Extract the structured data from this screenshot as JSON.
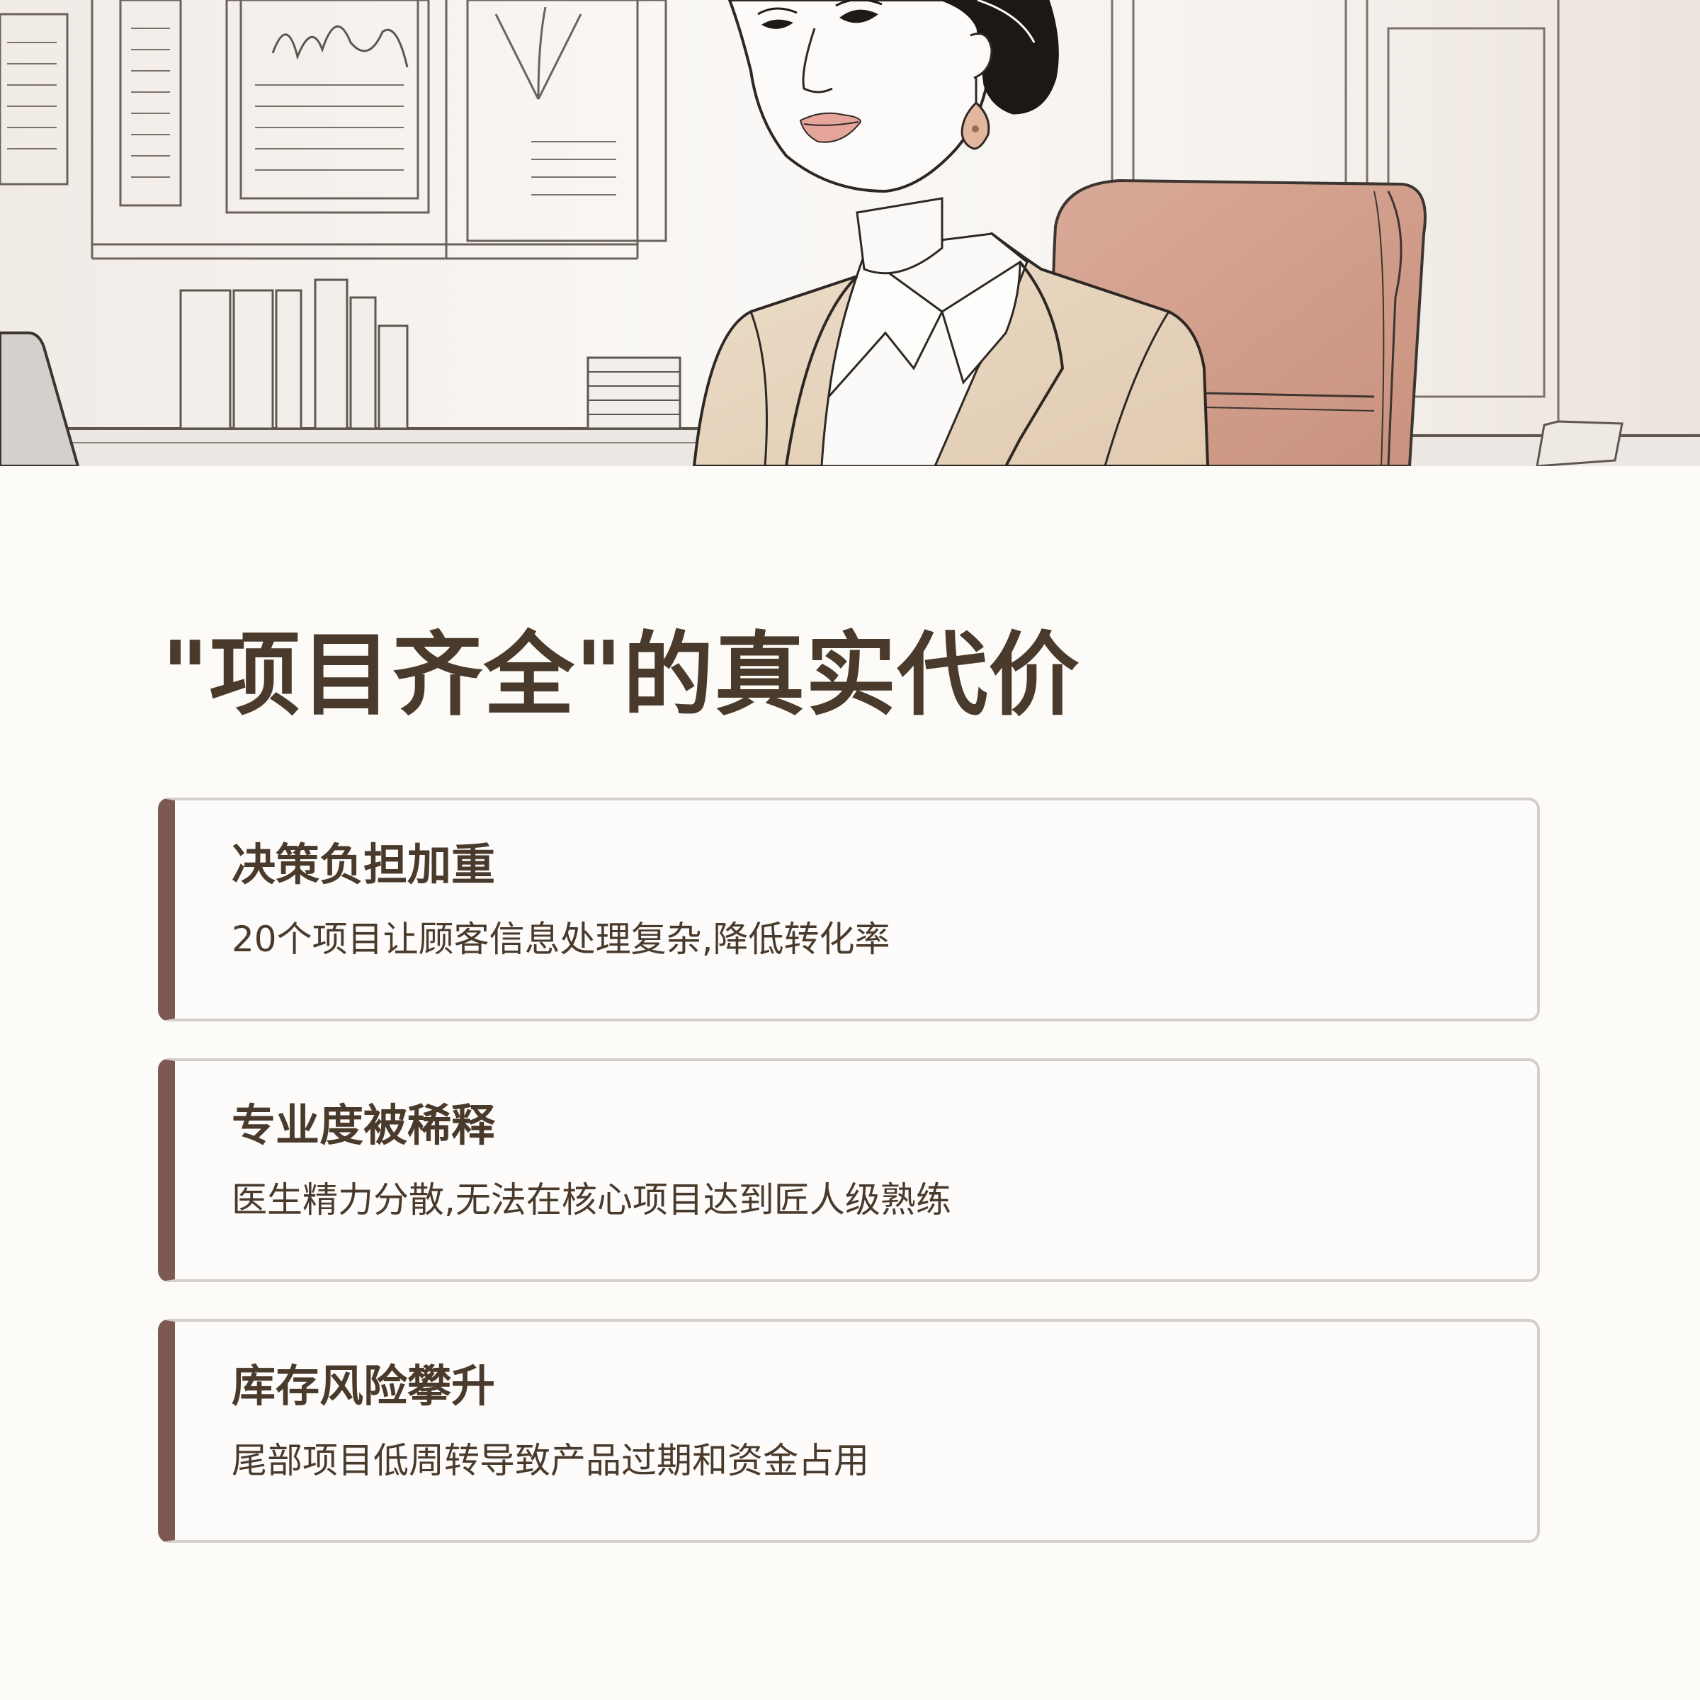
{
  "hero": {
    "image": "illustration of a woman in a beige blazer seated in an office chair"
  },
  "heading": {
    "title": "\"项目齐全\"的真实代价"
  },
  "cards": [
    {
      "title": "决策负担加重",
      "description": "20个项目让顾客信息处理复杂,降低转化率"
    },
    {
      "title": "专业度被稀释",
      "description": "医生精力分散,无法在核心项目达到匠人级熟练"
    },
    {
      "title": "库存风险攀升",
      "description": "尾部项目低周转导致产品过期和资金占用"
    }
  ],
  "colors": {
    "background": "#fdfbf8",
    "text": "#4a3a2c",
    "accent": "#7c5a52",
    "border": "#d4cfcc"
  }
}
